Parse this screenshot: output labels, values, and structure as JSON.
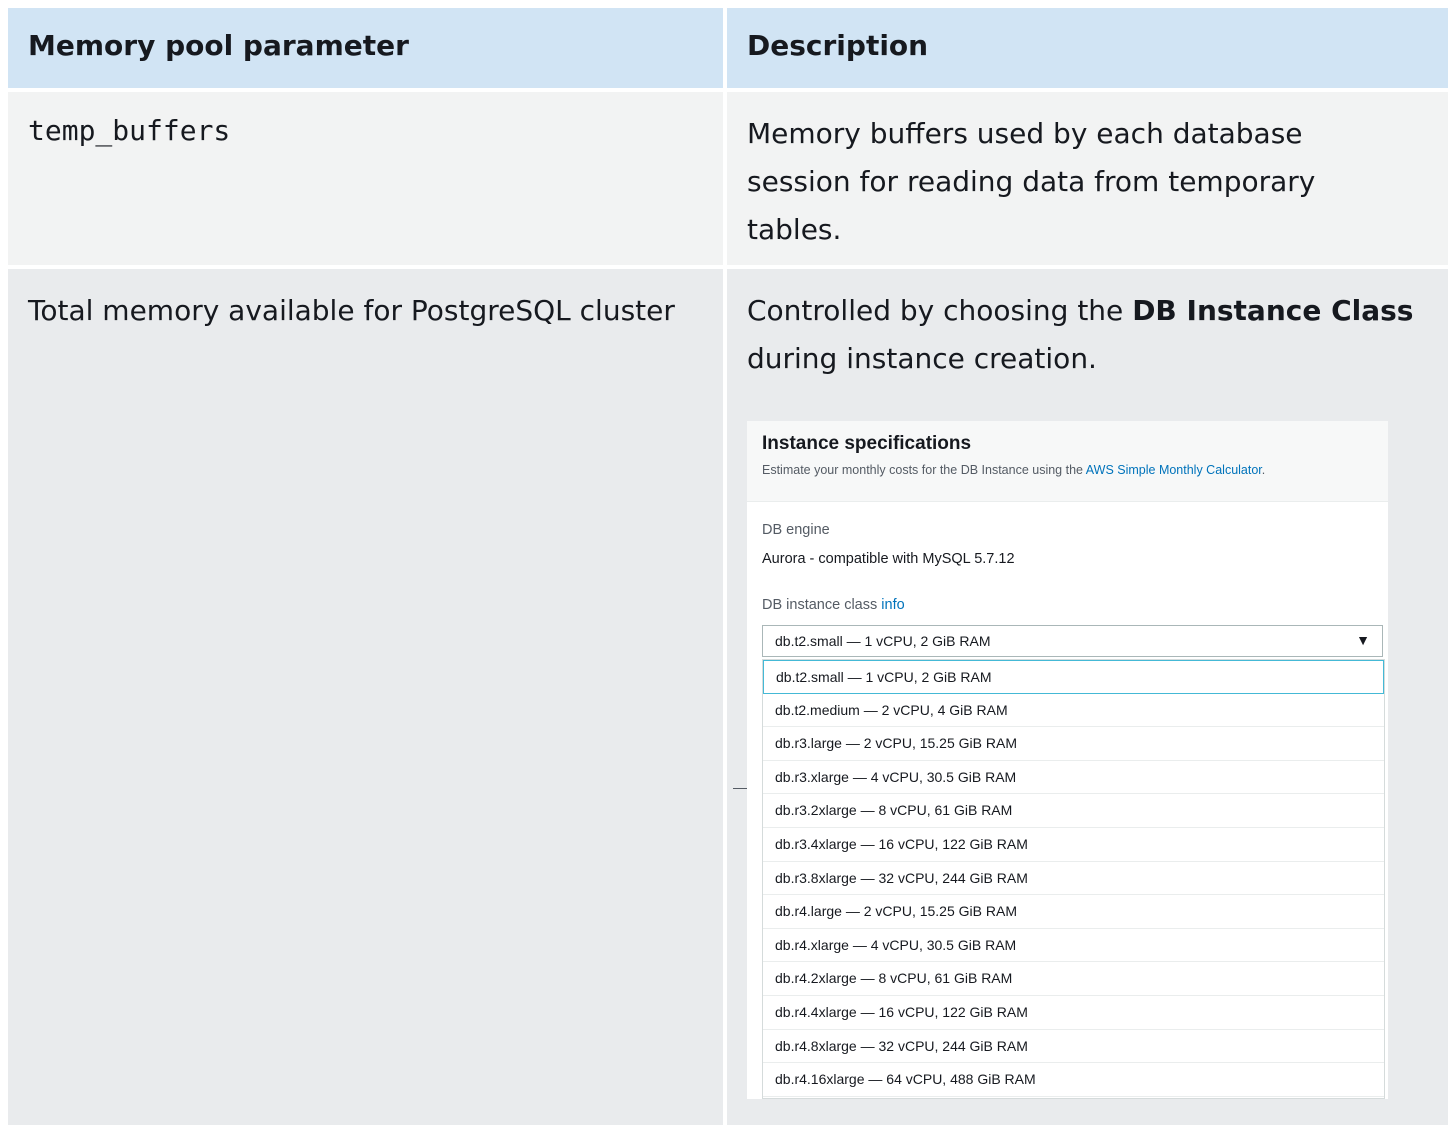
{
  "table": {
    "headers": [
      "Memory pool parameter",
      "Description"
    ],
    "row1": {
      "param": "temp_buffers",
      "description": "Memory buffers used by each database session for reading data from temporary tables."
    },
    "row2": {
      "param": "Total memory available for PostgreSQL cluster",
      "description_pre": "Controlled by choosing the ",
      "description_bold": "DB Instance Class",
      "description_post": " during instance creation."
    }
  },
  "screenshot": {
    "title": "Instance specifications",
    "subtitle_pre": "Estimate your monthly costs for the DB Instance using the ",
    "subtitle_link": "AWS Simple Monthly Calculator",
    "subtitle_post": ".",
    "engine_label": "DB engine",
    "engine_value": "Aurora - compatible with MySQL 5.7.12",
    "class_label": "DB instance class",
    "class_info": "info",
    "selected": "db.t2.small — 1 vCPU, 2 GiB RAM",
    "arrow": "▼",
    "options": [
      "db.t2.small — 1 vCPU, 2 GiB RAM",
      "db.t2.medium — 2 vCPU, 4 GiB RAM",
      "db.r3.large — 2 vCPU, 15.25 GiB RAM",
      "db.r3.xlarge — 4 vCPU, 30.5 GiB RAM",
      "db.r3.2xlarge — 8 vCPU, 61 GiB RAM",
      "db.r3.4xlarge — 16 vCPU, 122 GiB RAM",
      "db.r3.8xlarge — 32 vCPU, 244 GiB RAM",
      "db.r4.large — 2 vCPU, 15.25 GiB RAM",
      "db.r4.xlarge — 4 vCPU, 30.5 GiB RAM",
      "db.r4.2xlarge — 8 vCPU, 61 GiB RAM",
      "db.r4.4xlarge — 16 vCPU, 122 GiB RAM",
      "db.r4.8xlarge — 32 vCPU, 244 GiB RAM",
      "db.r4.16xlarge — 64 vCPU, 488 GiB RAM"
    ]
  }
}
